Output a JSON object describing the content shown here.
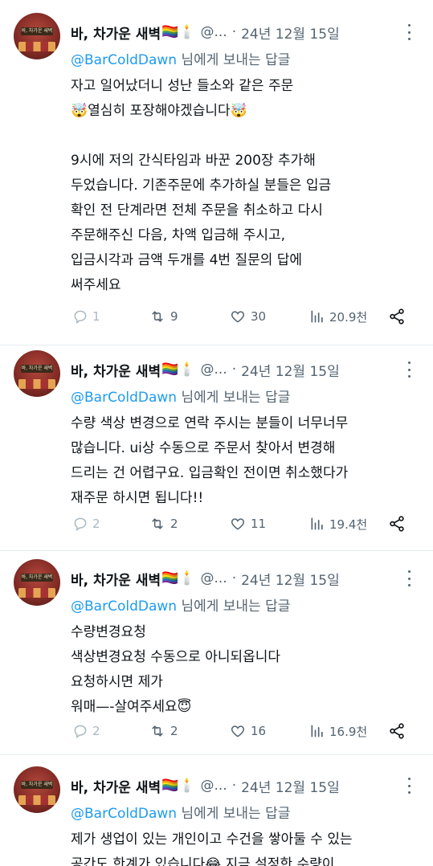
{
  "tweets": [
    {
      "author": "바, 차가운 새벽",
      "author_emoji": "🏳️‍🌈🕯️",
      "handle": "@...",
      "dot": "·",
      "date": "24년 12월 15일",
      "reply_to_handle": "@BarColdDawn",
      "reply_to_suffix": " 님에게 보내는 답글",
      "lines": [
        "자고 일어났더니 성난 들소와 같은 주문",
        "🤯열심히 포장해야겠습니다🤯",
        "",
        "9시에 저의 간식타임과 바꾼 200장 추가해",
        "두었습니다. 기존주문에 추가하실 분들은 입금",
        "확인 전 단계라면 전체 주문을 취소하고 다시",
        "주문해주신 다음, 차액 입금해 주시고,",
        "입금시각과 금액 두개를 4번 질문의 답에",
        "써주세요"
      ],
      "replies": "1",
      "retweets": "9",
      "likes": "30",
      "views": "20.9천"
    },
    {
      "author": "바, 차가운 새벽",
      "author_emoji": "🏳️‍🌈🕯️",
      "handle": "@...",
      "dot": "·",
      "date": "24년 12월 15일",
      "reply_to_handle": "@BarColdDawn",
      "reply_to_suffix": " 님에게 보내는 답글",
      "lines": [
        "수량 색상 변경으로 연락 주시는 분들이 너무너무",
        "많습니다. ui상 수동으로 주문서 찾아서 변경해",
        "드리는 건 어렵구요. 입금확인 전이면 취소했다가",
        "재주문 하시면 됩니다!!"
      ],
      "replies": "2",
      "retweets": "2",
      "likes": "11",
      "views": "19.4천"
    },
    {
      "author": "바, 차가운 새벽",
      "author_emoji": "🏳️‍🌈🕯️",
      "handle": "@...",
      "dot": "·",
      "date": "24년 12월 15일",
      "reply_to_handle": "@BarColdDawn",
      "reply_to_suffix": " 님에게 보내는 답글",
      "lines": [
        "수량변경요청",
        "색상변경요청 수동으로 아니되옵니다",
        "요청하시면 제가",
        "워매—-살여주세요😇"
      ],
      "replies": "2",
      "retweets": "2",
      "likes": "16",
      "views": "16.9천"
    },
    {
      "author": "바, 차가운 새벽",
      "author_emoji": "🏳️‍🌈🕯️",
      "handle": "@...",
      "dot": "·",
      "date": "24년 12월 15일",
      "reply_to_handle": "@BarColdDawn",
      "reply_to_suffix": " 님에게 보내는 답글",
      "lines": [
        "제가 생업이 있는 개인이고 수건을 쌓아둘 수 있는",
        "공간도 한계가 있습니다😂 지금 설정한 수량이"
      ]
    }
  ],
  "avatar_sign_text": "바, 차가운 새벽",
  "colors": {
    "text": "#0f1419",
    "secondary": "#536471",
    "link": "#1d9bf0",
    "divider": "#e6ecf0"
  }
}
